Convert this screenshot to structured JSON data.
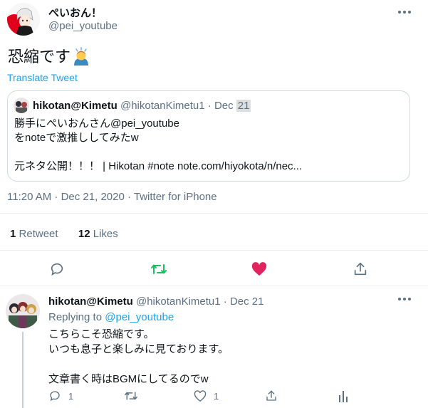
{
  "tweet": {
    "author_name": "ぺいおん！",
    "author_handle": "@pei_youtube",
    "text": "恐縮です",
    "translate_label": "Translate Tweet",
    "timestamp": "11:20 AM · Dec 21, 2020 · Twitter for iPhone"
  },
  "quote": {
    "name": "hikotan@Kimetu",
    "handle_date": "@hikotanKimetu1 · Dec ",
    "date_highlight": "21",
    "body": "勝手にぺいおんさん@pei_youtube\nをnoteで激推ししてみたw\n\n元ネタ公開！！！ | Hikotan #note note.com/hiyokota/n/nec..."
  },
  "stats": {
    "retweets_count": "1",
    "retweets_label": "Retweet",
    "likes_count": "12",
    "likes_label": "Likes"
  },
  "reply": {
    "name": "hikotan@Kimetu",
    "handle_date": "@hikotanKimetu1 · Dec 21",
    "replying_prefix": "Replying to ",
    "replying_to": "@pei_youtube",
    "body": "こちらこそ恐縮です。\nいつも息子と楽しみに見ております。\n\n文章書く時はBGMにしてるのでw",
    "reply_count": "1",
    "like_count": "1"
  },
  "colors": {
    "accent": "#1da1f2",
    "retweet_active": "#17bf63",
    "like_active": "#e0245e",
    "muted": "#5b7083"
  },
  "icons": [
    "more-icon",
    "reply-icon",
    "retweet-icon",
    "heart-icon",
    "share-icon",
    "analytics-icon"
  ]
}
